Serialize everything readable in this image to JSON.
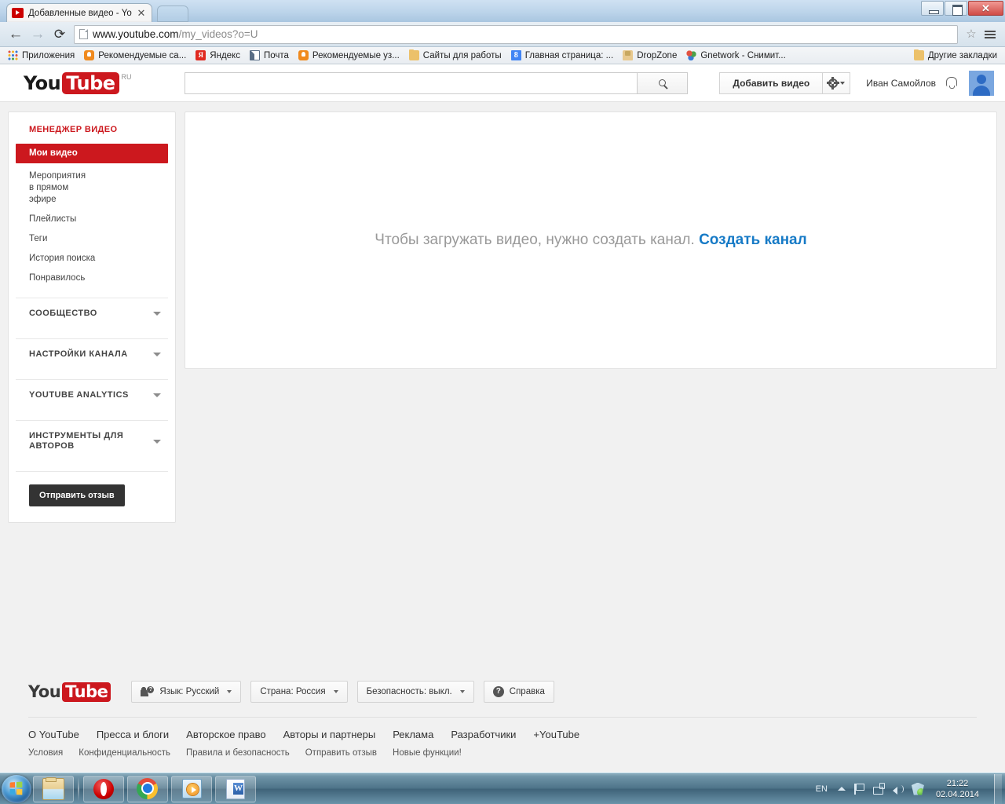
{
  "browser": {
    "tab": {
      "title": "Добавленные видео - Yo",
      "close_label": "✕"
    },
    "url_bold": "www.youtube.com",
    "url_rest": "/my_videos?o=U",
    "back_label": "←",
    "forward_label": "→",
    "reload_label": "⟳",
    "star_label": "☆",
    "window_controls": {
      "minimize": "",
      "maximize": "",
      "close": "✕"
    }
  },
  "bookmarks": [
    {
      "label": "Приложения",
      "icon": "apps-grid-icon"
    },
    {
      "label": "Рекомендуемые са...",
      "icon": "bulb-icon"
    },
    {
      "label": "Яндекс",
      "icon": "yandex-icon",
      "glyph": "Я"
    },
    {
      "label": "Почта",
      "icon": "mail-icon"
    },
    {
      "label": "Рекомендуемые уз...",
      "icon": "bulb-icon"
    },
    {
      "label": "Сайты для работы",
      "icon": "folder-icon"
    },
    {
      "label": "Главная страница: ...",
      "icon": "google-icon",
      "glyph": "8"
    },
    {
      "label": "DropZone",
      "icon": "dropzone-icon"
    },
    {
      "label": "Gnetwork - Снимит...",
      "icon": "gnetwork-icon"
    }
  ],
  "bookmarks_other": {
    "label": "Другие закладки",
    "icon": "folder-icon"
  },
  "youtube": {
    "logo": {
      "you": "You",
      "tube": "Tube",
      "country_code": "RU"
    },
    "search": {
      "value": "",
      "placeholder": ""
    },
    "upload_button": "Добавить видео",
    "username": "Иван Самойлов"
  },
  "sidebar": {
    "title": "МЕНЕДЖЕР ВИДЕО",
    "items": [
      {
        "label": "Мои видео",
        "active": true
      },
      {
        "label": "Мероприятия в прямом эфире",
        "active": false
      },
      {
        "label": "Плейлисты",
        "active": false
      },
      {
        "label": "Теги",
        "active": false
      },
      {
        "label": "История поиска",
        "active": false
      },
      {
        "label": "Понравилось",
        "active": false
      }
    ],
    "groups": [
      {
        "label": "СООБЩЕСТВО"
      },
      {
        "label": "НАСТРОЙКИ КАНАЛА"
      },
      {
        "label": "YOUTUBE ANALYTICS"
      },
      {
        "label": "ИНСТРУМЕНТЫ ДЛЯ АВТОРОВ"
      }
    ],
    "feedback_button": "Отправить отзыв"
  },
  "main": {
    "empty_text": "Чтобы загружать видео, нужно создать канал.",
    "empty_link": "Создать канал"
  },
  "footer": {
    "logo": {
      "you": "You",
      "tube": "Tube"
    },
    "buttons": [
      {
        "label": "Язык: Русский",
        "icon": "language-icon",
        "caret": true
      },
      {
        "label": "Страна: Россия",
        "icon": "none",
        "caret": true
      },
      {
        "label": "Безопасность: выкл.",
        "icon": "none",
        "caret": true
      },
      {
        "label": "Справка",
        "icon": "help-icon",
        "caret": false
      }
    ],
    "links_primary": [
      "О YouTube",
      "Пресса и блоги",
      "Авторское право",
      "Авторы и партнеры",
      "Реклама",
      "Разработчики",
      "+YouTube"
    ],
    "links_secondary": [
      "Условия",
      "Конфиденциальность",
      "Правила и безопасность",
      "Отправить отзыв",
      "Новые функции!"
    ]
  },
  "taskbar": {
    "start_label": "start-orb",
    "items": [
      {
        "name": "explorer",
        "icon": "folder-explorer-icon"
      },
      {
        "name": "opera",
        "icon": "opera-icon"
      },
      {
        "name": "chrome",
        "icon": "chrome-icon"
      },
      {
        "name": "media-player",
        "icon": "windows-media-player-icon"
      },
      {
        "name": "word",
        "icon": "word-icon"
      }
    ],
    "tray": {
      "language": "EN",
      "time": "21:22",
      "date": "02.04.2014"
    }
  },
  "colors": {
    "brand_red": "#cc181e",
    "link_blue": "#167ac6",
    "page_bg": "#f1f1f1",
    "muted_text": "#999999"
  }
}
